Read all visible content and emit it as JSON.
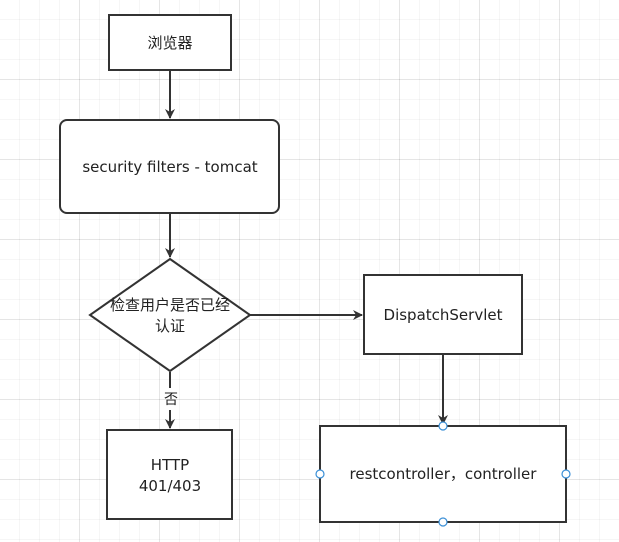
{
  "diagram": {
    "nodes": {
      "browser": {
        "label": "浏览器"
      },
      "security_filters": {
        "label": "security filters - tomcat"
      },
      "auth_check": {
        "label_line1": "检查用户是否已经",
        "label_line2": "认证"
      },
      "http_error": {
        "label_line1": "HTTP",
        "label_line2": "401/403"
      },
      "dispatch_servlet": {
        "label": "DispatchServlet"
      },
      "rest_controller": {
        "label": "restcontroller，controller"
      }
    },
    "edges": {
      "no_label": "否"
    }
  },
  "colors": {
    "stroke": "#333333",
    "selection_handle": "#3a8fd6"
  }
}
